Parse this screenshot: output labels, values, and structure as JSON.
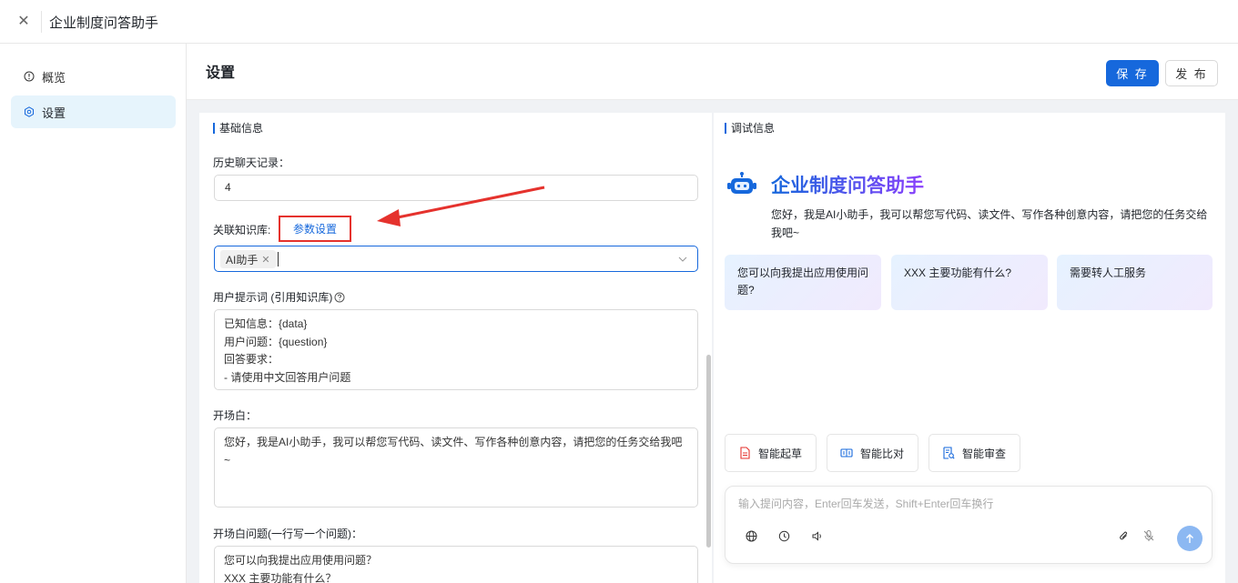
{
  "window": {
    "title": "企业制度问答助手"
  },
  "sidebar": {
    "items": [
      {
        "label": "概览",
        "icon": "info-circle-icon",
        "active": false
      },
      {
        "label": "设置",
        "icon": "gear-icon",
        "active": true
      }
    ]
  },
  "header": {
    "title": "设置",
    "save_label": "保 存",
    "publish_label": "发 布"
  },
  "basic": {
    "section_title": "基础信息",
    "history_label": "历史聊天记录：",
    "history_value": "4",
    "kb_label": "关联知识库:",
    "param_link": "参数设置",
    "kb_tag": "AI助手",
    "prompt_label": "用户提示词 (引用知识库) ",
    "prompt_lines": [
      "已知信息：{data}",
      "用户问题：{question}",
      "回答要求：",
      "- 请使用中文回答用户问题"
    ],
    "opening_label": "开场白：",
    "opening_text": "您好，我是AI小助手，我可以帮您写代码、读文件、写作各种创意内容，请把您的任务交给我吧~",
    "opening_questions_label": "开场白问题(一行写一个问题)：",
    "opening_questions": [
      "您可以向我提出应用使用问题？",
      "XXX 主要功能有什么？"
    ]
  },
  "debug": {
    "section_title": "调试信息",
    "bot_title": "企业制度问答助手",
    "greeting": "您好，我是AI小助手，我可以帮您写代码、读文件、写作各种创意内容，请把您的任务交给我吧~",
    "suggestions": [
      "您可以向我提出应用使用问题?",
      "XXX 主要功能有什么?",
      "需要转人工服务"
    ],
    "tools": [
      {
        "label": "智能起草",
        "icon": "document-icon",
        "color": "#e5322d"
      },
      {
        "label": "智能比对",
        "icon": "compare-icon",
        "color": "#1668dc"
      },
      {
        "label": "智能审查",
        "icon": "review-icon",
        "color": "#1668dc"
      }
    ],
    "input_placeholder": "输入提问内容，Enter回车发送，Shift+Enter回车换行"
  },
  "colors": {
    "primary": "#1668dc",
    "highlight": "#e5322d",
    "active_bg": "#e6f4fc"
  }
}
